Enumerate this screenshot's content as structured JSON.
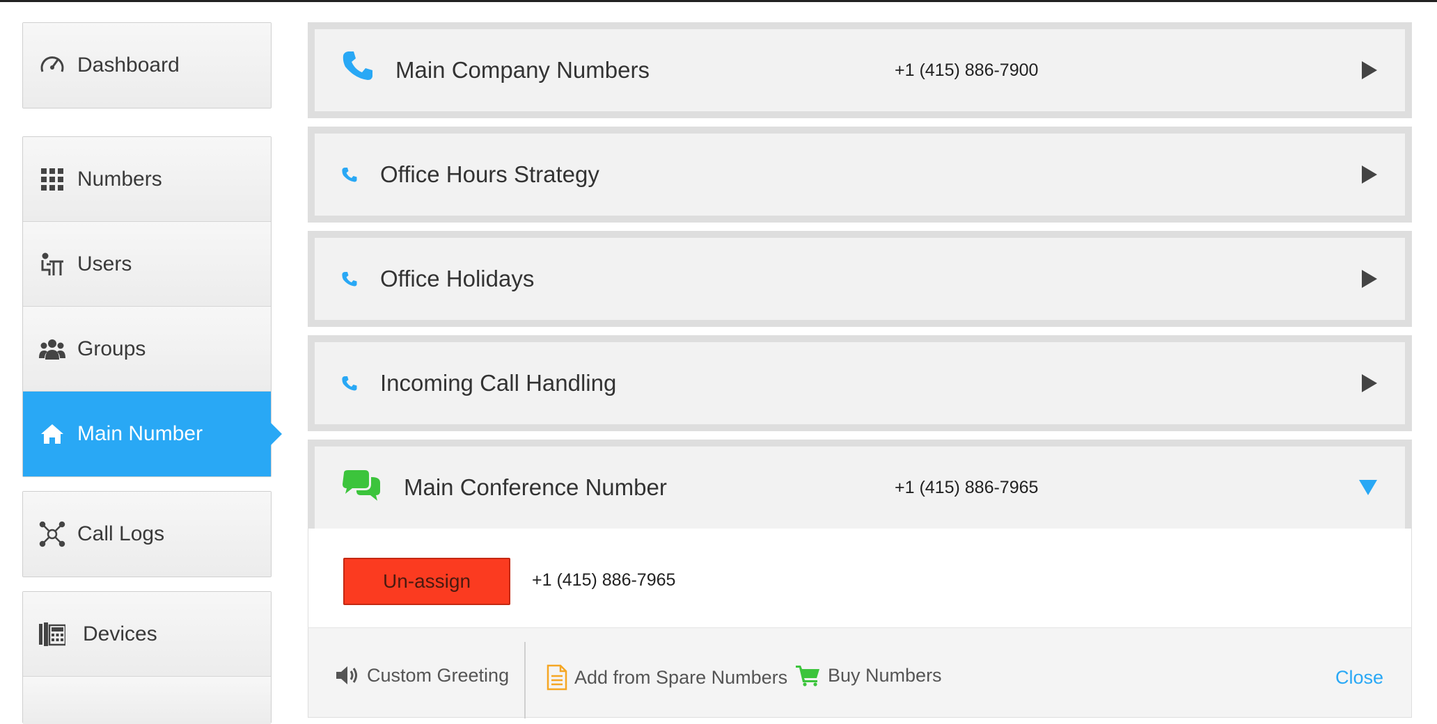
{
  "colors": {
    "accent": "#29a8f5",
    "danger": "#fb3b20",
    "conference_green": "#3cc43c",
    "doc_orange": "#f5a623",
    "cart_green": "#3cc43c"
  },
  "sidebar": {
    "dashboard": {
      "label": "Dashboard",
      "icon": "dashboard-gauge-icon"
    },
    "items": [
      {
        "label": "Numbers",
        "icon": "keypad-grid-icon"
      },
      {
        "label": "Users",
        "icon": "user-desk-icon"
      },
      {
        "label": "Groups",
        "icon": "group-people-icon"
      },
      {
        "label": "Main Number",
        "icon": "home-icon",
        "active": true
      }
    ],
    "call_logs": {
      "label": "Call Logs",
      "icon": "network-nodes-icon"
    },
    "devices": {
      "label": "Devices",
      "icon": "desk-phone-icon"
    }
  },
  "panels": [
    {
      "title": "Main Company Numbers",
      "number": "+1 (415) 886-7900",
      "icon": "phone-icon"
    },
    {
      "title": "Office Hours Strategy",
      "number": "",
      "icon": "phone-small-icon"
    },
    {
      "title": "Office Holidays",
      "number": "",
      "icon": "phone-small-icon"
    },
    {
      "title": "Incoming Call Handling",
      "number": "",
      "icon": "phone-small-icon"
    },
    {
      "title": "Main Conference Number",
      "number": "+1 (415) 886-7965",
      "icon": "chat-bubbles-icon",
      "expanded": true
    }
  ],
  "expanded": {
    "unassign_label": "Un-assign",
    "assigned_number": "+1 (415) 886-7965"
  },
  "actions": {
    "custom_greeting": "Custom Greeting",
    "add_spare": "Add from Spare Numbers",
    "buy_numbers": "Buy Numbers",
    "close": "Close"
  }
}
